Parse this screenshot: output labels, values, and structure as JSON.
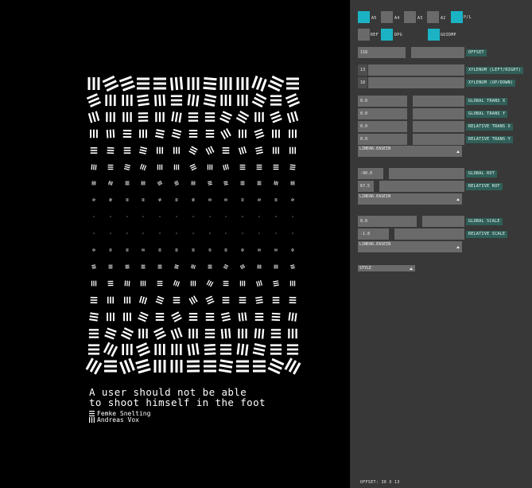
{
  "poster": {
    "title_line1": "A user should not be able",
    "title_line2": "to shoot himself in the foot",
    "credits": [
      {
        "glyph": "horizontal-bars-icon",
        "name": "Femke Snelting"
      },
      {
        "glyph": "vertical-bars-icon",
        "name": "Andreas Vox"
      }
    ]
  },
  "panel": {
    "formats": [
      {
        "label": "A5",
        "active": true
      },
      {
        "label": "A4",
        "active": false
      },
      {
        "label": "A3",
        "active": false
      },
      {
        "label": "A2",
        "active": false
      },
      {
        "label": "P/L",
        "active": true
      }
    ],
    "toggles": [
      {
        "label": "REF",
        "active": false
      },
      {
        "label": "DPG",
        "active": true
      },
      {
        "label": "GUIDMP",
        "active": true
      }
    ],
    "offset": {
      "value": "118",
      "label": "OFFSET"
    },
    "xylenum_lr": {
      "value": "13",
      "label": "XYLENUM  (LEFT/RIGHT)"
    },
    "xylenum_ud": {
      "value": "18",
      "label": "XYLENUM  (UP/DOWN)"
    },
    "global_trans_x": {
      "value": "0.0",
      "label": "GLOBAL TRANS X"
    },
    "global_trans_y": {
      "value": "0.0",
      "label": "GLOBAL TRANS Y"
    },
    "relative_trans_x": {
      "value": "0.0",
      "label": "RELATIVE TRANS X"
    },
    "relative_trans_y": {
      "value": "0.0",
      "label": "RELATIVE TRANS Y"
    },
    "easing1": "LINEAR.EASEIN",
    "global_rot": {
      "value": "-90.0",
      "label": "GLOBAL ROT"
    },
    "relative_rot": {
      "value": "67.5",
      "label": "RELATIVE ROT"
    },
    "easing2": "LINEAR.EASEIN",
    "global_scale": {
      "value": "0.8",
      "label": "GLOBAL SCALE"
    },
    "relative_scale": {
      "value": "-1.8",
      "label": "RELATIVE SCALE"
    },
    "easing3": "LINEAR.EASEIN",
    "style": "STYLE",
    "footer": "OFFSET: 30 X 13"
  },
  "colors": {
    "accent": "#1bb3c4",
    "tag": "#2f5f58",
    "panel": "#383838",
    "field": "#6a6a6a"
  }
}
